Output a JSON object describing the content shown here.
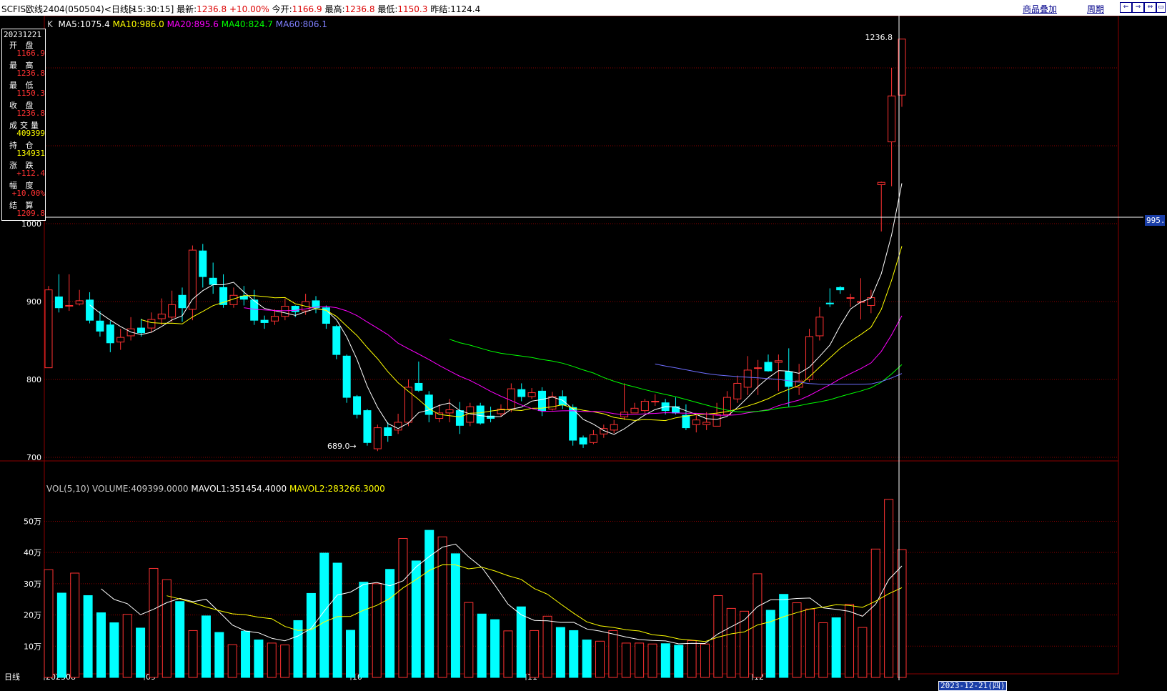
{
  "header": {
    "title": "SCFIS欧线2404(050504)<日线>",
    "time": "[15:30:15]",
    "latest_label": "最新:",
    "latest_value": "1236.8 +10.00%",
    "open_label": "今开:",
    "open_value": "1166.9",
    "high_label": "最高:",
    "high_value": "1236.8",
    "low_label": "最低:",
    "low_value": "1150.3",
    "prev_label": "昨结:",
    "prev_value": "1124.4",
    "overlay_link": "商品叠加",
    "period_link": "周期"
  },
  "info_panel": {
    "date": "20231221",
    "items": [
      {
        "label": "开 盘",
        "value": "1166.9",
        "color": "#ff3232"
      },
      {
        "label": "最 高",
        "value": "1236.8",
        "color": "#ff3232"
      },
      {
        "label": "最 低",
        "value": "1150.3",
        "color": "#ff3232"
      },
      {
        "label": "收 盘",
        "value": "1236.8",
        "color": "#ff3232"
      },
      {
        "label": "成交量",
        "value": "409399",
        "color": "#ffff00"
      },
      {
        "label": "持 仓",
        "value": "134931",
        "color": "#ffff00"
      },
      {
        "label": "涨 跌",
        "value": "+112.4",
        "color": "#ff3232"
      },
      {
        "label": "幅 度",
        "value": "+10.00%",
        "color": "#ff3232"
      },
      {
        "label": "结 算",
        "value": "1209.8",
        "color": "#ff3232"
      }
    ]
  },
  "legend": {
    "k_label": "K",
    "ma5": "MA5:1075.4",
    "ma10": "MA10:986.0",
    "ma20": "MA20:895.6",
    "ma40": "MA40:824.7",
    "ma60": "MA60:806.1"
  },
  "vol_legend": {
    "label": "VOL(5,10)",
    "volume": "VOLUME:409399.0000",
    "mavol1": "MAVOL1:351454.4000",
    "mavol2": "MAVOL2:283266.3000"
  },
  "colors": {
    "up": "#ff3232",
    "down": "#00ffff",
    "ma5": "#ffffff",
    "ma10": "#ffff00",
    "ma20": "#ff00ff",
    "ma40": "#00ff00",
    "ma60": "#6e6eff",
    "grid": "#8b0000"
  },
  "labels": {
    "high_marker": "1236.8",
    "low_marker": "689.0→",
    "crosshair_price": "995.",
    "crosshair_date": "2023-12-21(四)",
    "period_name": "日线"
  },
  "chart_data": {
    "type": "candlestick",
    "x_labels": [
      "202308",
      "09",
      "10",
      "11",
      "12"
    ],
    "y_ticks": [
      700,
      800,
      900,
      1000
    ],
    "vol_ticks": [
      "10万",
      "20万",
      "30万",
      "40万",
      "50万"
    ],
    "ylim": [
      680,
      1250
    ],
    "candles": [
      [
        815,
        915,
        900,
        920
      ],
      [
        906,
        892,
        886,
        935
      ],
      [
        895,
        895,
        888,
        935
      ],
      [
        897,
        901,
        895,
        915
      ],
      [
        902,
        876,
        872,
        912
      ],
      [
        875,
        862,
        855,
        888
      ],
      [
        870,
        847,
        835,
        875
      ],
      [
        848,
        854,
        838,
        865
      ],
      [
        856,
        865,
        850,
        880
      ],
      [
        866,
        860,
        855,
        878
      ],
      [
        866,
        877,
        860,
        886
      ],
      [
        878,
        884,
        870,
        904
      ],
      [
        880,
        896,
        874,
        914
      ],
      [
        908,
        892,
        874,
        918
      ],
      [
        890,
        966,
        876,
        972
      ],
      [
        965,
        932,
        918,
        974
      ],
      [
        930,
        922,
        910,
        950
      ],
      [
        918,
        896,
        892,
        935
      ],
      [
        896,
        908,
        892,
        918
      ],
      [
        907,
        903,
        895,
        920
      ],
      [
        902,
        876,
        870,
        915
      ],
      [
        876,
        873,
        865,
        882
      ],
      [
        875,
        881,
        870,
        890
      ],
      [
        881,
        894,
        876,
        904
      ],
      [
        894,
        887,
        880,
        895
      ],
      [
        888,
        900,
        883,
        910
      ],
      [
        901,
        892,
        885,
        907
      ],
      [
        892,
        872,
        865,
        895
      ],
      [
        868,
        832,
        826,
        870
      ],
      [
        830,
        777,
        770,
        832
      ],
      [
        778,
        755,
        750,
        780
      ],
      [
        760,
        719,
        715,
        762
      ],
      [
        711,
        738,
        708,
        742
      ],
      [
        738,
        728,
        720,
        745
      ],
      [
        735,
        745,
        730,
        756
      ],
      [
        745,
        790,
        740,
        800
      ],
      [
        795,
        786,
        784,
        823
      ],
      [
        780,
        755,
        745,
        785
      ],
      [
        750,
        757,
        745,
        768
      ],
      [
        757,
        761,
        745,
        775
      ],
      [
        760,
        741,
        730,
        771
      ],
      [
        745,
        765,
        740,
        770
      ],
      [
        766,
        744,
        742,
        770
      ],
      [
        753,
        750,
        745,
        765
      ],
      [
        756,
        762,
        752,
        768
      ],
      [
        762,
        788,
        758,
        795
      ],
      [
        787,
        778,
        772,
        795
      ],
      [
        778,
        783,
        775,
        789
      ],
      [
        785,
        760,
        753,
        790
      ],
      [
        762,
        778,
        760,
        784
      ],
      [
        778,
        767,
        762,
        786
      ],
      [
        764,
        722,
        715,
        768
      ],
      [
        725,
        717,
        712,
        728
      ],
      [
        719,
        729,
        717,
        735
      ],
      [
        730,
        737,
        725,
        742
      ],
      [
        735,
        742,
        731,
        748
      ],
      [
        752,
        758,
        748,
        795
      ],
      [
        757,
        763,
        757,
        770
      ],
      [
        760,
        772,
        757,
        775
      ],
      [
        772,
        772,
        766,
        781
      ],
      [
        770,
        760,
        755,
        775
      ],
      [
        765,
        757,
        755,
        777
      ],
      [
        754,
        738,
        735,
        768
      ],
      [
        742,
        748,
        732,
        754
      ],
      [
        742,
        745,
        735,
        758
      ],
      [
        740,
        755,
        740,
        770
      ],
      [
        755,
        777,
        754,
        785
      ],
      [
        775,
        795,
        770,
        805
      ],
      [
        790,
        812,
        780,
        830
      ],
      [
        815,
        815,
        780,
        825
      ],
      [
        822,
        811,
        810,
        832
      ],
      [
        822,
        824,
        785,
        832
      ],
      [
        810,
        791,
        765,
        840
      ],
      [
        790,
        798,
        780,
        820
      ],
      [
        800,
        855,
        797,
        865
      ],
      [
        856,
        880,
        850,
        893
      ],
      [
        898,
        897,
        893,
        917
      ],
      [
        918,
        915,
        910,
        920
      ],
      [
        905,
        905,
        893,
        910
      ],
      [
        900,
        900,
        877,
        930
      ],
      [
        895,
        905,
        885,
        915
      ],
      [
        1050,
        1053,
        990,
        1054
      ],
      [
        1105,
        1164,
        1048,
        1200
      ],
      [
        1165,
        1237,
        1150,
        1237
      ]
    ],
    "volumes": [
      345,
      270,
      334,
      262,
      207,
      175,
      202,
      158,
      349,
      313,
      243,
      150,
      197,
      144,
      105,
      148,
      120,
      110,
      104,
      182,
      269,
      398,
      366,
      151,
      305,
      300,
      346,
      445,
      373,
      471,
      450,
      396,
      240,
      203,
      185,
      149,
      226,
      150,
      196,
      160,
      150,
      120,
      116,
      150,
      110,
      110,
      107,
      108,
      103,
      118,
      107,
      262,
      221,
      212,
      332,
      215,
      266,
      239,
      219,
      175,
      191,
      234,
      160,
      411,
      570,
      409
    ],
    "series": [
      {
        "name": "MA5"
      },
      {
        "name": "MA10"
      },
      {
        "name": "MA20"
      },
      {
        "name": "MA40"
      },
      {
        "name": "MA60"
      }
    ]
  }
}
